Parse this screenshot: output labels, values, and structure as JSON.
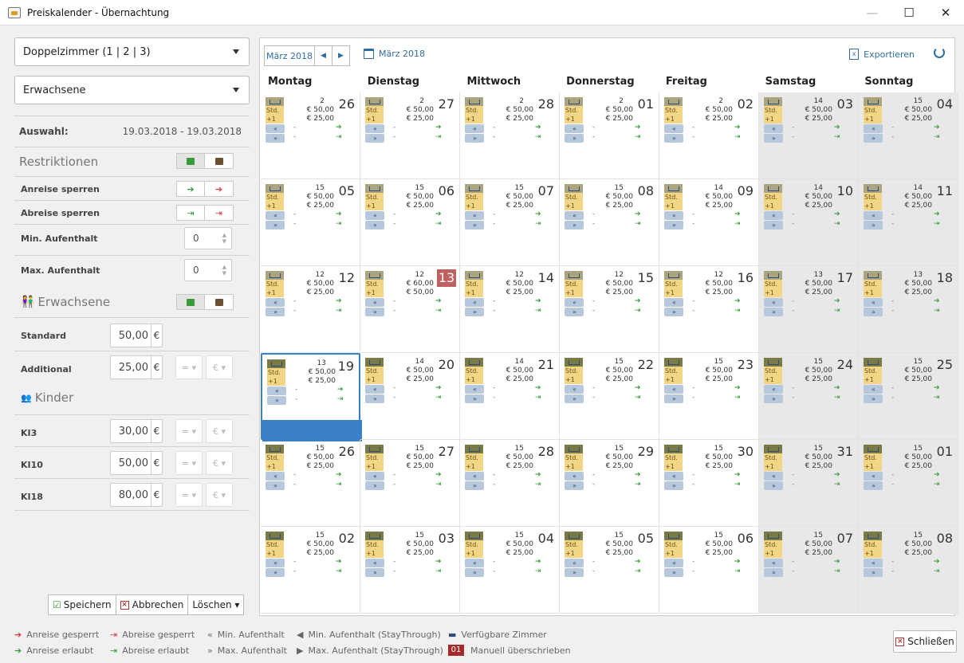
{
  "window": {
    "title": "Preiskalender - Übernachtung",
    "minimize": "—",
    "maximize": "☐",
    "close": "✕"
  },
  "left": {
    "room_select": "Doppelzimmer (1 | 2 | 3)",
    "guest_select": "Erwachsene",
    "selection_label": "Auswahl:",
    "selection_range": "19.03.2018 - 19.03.2018",
    "restrictions_label": "Restriktionen",
    "arrival_lock_label": "Anreise sperren",
    "departure_lock_label": "Abreise sperren",
    "min_stay_label": "Min. Aufenthalt",
    "min_stay_value": "0",
    "max_stay_label": "Max. Aufenthalt",
    "max_stay_value": "0",
    "adults_label": "Erwachsene",
    "standard_label": "Standard",
    "standard_value": "50,00",
    "additional_label": "Additional",
    "additional_value": "25,00",
    "children_label": "Kinder",
    "ki3_label": "KI3",
    "ki3_value": "30,00",
    "ki10_label": "KI10",
    "ki10_value": "50,00",
    "ki18_label": "KI18",
    "ki18_value": "80,00",
    "currency": "€",
    "op_equal": "= ▾",
    "op_currency": "€ ▾",
    "save": "Speichern",
    "cancel": "Abbrechen",
    "delete": "Löschen ▾"
  },
  "calendar": {
    "nav_month": "März 2018",
    "prev": "◀",
    "next": "▶",
    "current_month": "März 2018",
    "export": "Exportieren",
    "days": [
      "Montag",
      "Dienstag",
      "Mittwoch",
      "Donnerstag",
      "Freitag",
      "Samstag",
      "Sonntag"
    ],
    "std": "Std.",
    "plus": "+1",
    "min": "«",
    "max": "»",
    "dash": "-",
    "cells": [
      {
        "d": "26",
        "c": "2",
        "p": "€ 50,00",
        "a": "€ 25,00"
      },
      {
        "d": "27",
        "c": "2",
        "p": "€ 50,00",
        "a": "€ 25,00"
      },
      {
        "d": "28",
        "c": "2",
        "p": "€ 50,00",
        "a": "€ 25,00"
      },
      {
        "d": "01",
        "c": "2",
        "p": "€ 50,00",
        "a": "€ 25,00"
      },
      {
        "d": "02",
        "c": "2",
        "p": "€ 50,00",
        "a": "€ 25,00"
      },
      {
        "d": "03",
        "c": "14",
        "p": "€ 50,00",
        "a": "€ 25,00"
      },
      {
        "d": "04",
        "c": "15",
        "p": "€ 50,00",
        "a": "€ 25,00"
      },
      {
        "d": "05",
        "c": "15",
        "p": "€ 50,00",
        "a": "€ 25,00"
      },
      {
        "d": "06",
        "c": "15",
        "p": "€ 50,00",
        "a": "€ 25,00"
      },
      {
        "d": "07",
        "c": "15",
        "p": "€ 50,00",
        "a": "€ 25,00"
      },
      {
        "d": "08",
        "c": "15",
        "p": "€ 50,00",
        "a": "€ 25,00"
      },
      {
        "d": "09",
        "c": "14",
        "p": "€ 50,00",
        "a": "€ 25,00"
      },
      {
        "d": "10",
        "c": "14",
        "p": "€ 50,00",
        "a": "€ 25,00"
      },
      {
        "d": "11",
        "c": "14",
        "p": "€ 50,00",
        "a": "€ 25,00"
      },
      {
        "d": "12",
        "c": "12",
        "p": "€ 50,00",
        "a": "€ 25,00"
      },
      {
        "d": "13",
        "c": "12",
        "p": "€ 60,00",
        "a": "€ 50,00",
        "manual": true
      },
      {
        "d": "14",
        "c": "12",
        "p": "€ 50,00",
        "a": "€ 25,00"
      },
      {
        "d": "15",
        "c": "12",
        "p": "€ 50,00",
        "a": "€ 25,00"
      },
      {
        "d": "16",
        "c": "12",
        "p": "€ 50,00",
        "a": "€ 25,00"
      },
      {
        "d": "17",
        "c": "13",
        "p": "€ 50,00",
        "a": "€ 25,00"
      },
      {
        "d": "18",
        "c": "13",
        "p": "€ 50,00",
        "a": "€ 25,00"
      },
      {
        "d": "19",
        "c": "13",
        "p": "€ 50,00",
        "a": "€ 25,00",
        "selected": true
      },
      {
        "d": "20",
        "c": "14",
        "p": "€ 50,00",
        "a": "€ 25,00"
      },
      {
        "d": "21",
        "c": "14",
        "p": "€ 50,00",
        "a": "€ 25,00"
      },
      {
        "d": "22",
        "c": "15",
        "p": "€ 50,00",
        "a": "€ 25,00"
      },
      {
        "d": "23",
        "c": "15",
        "p": "€ 50,00",
        "a": "€ 25,00"
      },
      {
        "d": "24",
        "c": "15",
        "p": "€ 50,00",
        "a": "€ 25,00"
      },
      {
        "d": "25",
        "c": "15",
        "p": "€ 50,00",
        "a": "€ 25,00"
      },
      {
        "d": "26",
        "c": "15",
        "p": "€ 50,00",
        "a": "€ 25,00"
      },
      {
        "d": "27",
        "c": "15",
        "p": "€ 50,00",
        "a": "€ 25,00"
      },
      {
        "d": "28",
        "c": "15",
        "p": "€ 50,00",
        "a": "€ 25,00"
      },
      {
        "d": "29",
        "c": "15",
        "p": "€ 50,00",
        "a": "€ 25,00"
      },
      {
        "d": "30",
        "c": "15",
        "p": "€ 50,00",
        "a": "€ 25,00"
      },
      {
        "d": "31",
        "c": "15",
        "p": "€ 50,00",
        "a": "€ 25,00"
      },
      {
        "d": "01",
        "c": "15",
        "p": "€ 50,00",
        "a": "€ 25,00"
      },
      {
        "d": "02",
        "c": "15",
        "p": "€ 50,00",
        "a": "€ 25,00"
      },
      {
        "d": "03",
        "c": "15",
        "p": "€ 50,00",
        "a": "€ 25,00"
      },
      {
        "d": "04",
        "c": "15",
        "p": "€ 50,00",
        "a": "€ 25,00"
      },
      {
        "d": "05",
        "c": "15",
        "p": "€ 50,00",
        "a": "€ 25,00"
      },
      {
        "d": "06",
        "c": "15",
        "p": "€ 50,00",
        "a": "€ 25,00"
      },
      {
        "d": "07",
        "c": "15",
        "p": "€ 50,00",
        "a": "€ 25,00"
      },
      {
        "d": "08",
        "c": "15",
        "p": "€ 50,00",
        "a": "€ 25,00"
      }
    ]
  },
  "legend": {
    "arrival_blocked": "Anreise gesperrt",
    "departure_blocked": "Abreise gesperrt",
    "min_stay": "Min. Aufenthalt",
    "min_stay_through": "Min. Aufenthalt (StayThrough)",
    "available_rooms": "Verfügbare Zimmer",
    "arrival_allowed": "Anreise erlaubt",
    "departure_allowed": "Abreise erlaubt",
    "max_stay": "Max. Aufenthalt",
    "max_stay_through": "Max. Aufenthalt (StayThrough)",
    "manual_sample": "01",
    "manual": "Manuell überschrieben",
    "close": "Schließen"
  },
  "colors": {
    "accent": "#2e6da4",
    "selected": "#3a80c8",
    "manual": "#c06060",
    "std_tag": "#f3d685"
  }
}
